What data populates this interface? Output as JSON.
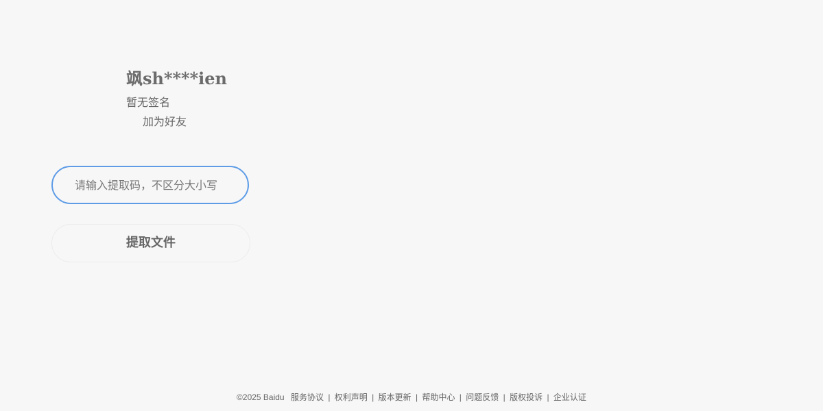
{
  "profile": {
    "username": "飒sh****ien",
    "signature": "暂无签名",
    "add_friend_label": "加为好友"
  },
  "extract": {
    "code_placeholder": "请输入提取码，不区分大小写",
    "code_value": "",
    "button_label": "提取文件"
  },
  "footer": {
    "copyright": "©2025 Baidu",
    "separator": "|",
    "links": [
      {
        "label": "服务协议"
      },
      {
        "label": "权利声明"
      },
      {
        "label": "版本更新"
      },
      {
        "label": "帮助中心"
      },
      {
        "label": "问题反馈"
      },
      {
        "label": "版权投诉"
      },
      {
        "label": "企业认证"
      }
    ]
  },
  "colors": {
    "background": "#f7f7f7",
    "input_border_focus": "#5e9ce7",
    "text": "#666666"
  }
}
